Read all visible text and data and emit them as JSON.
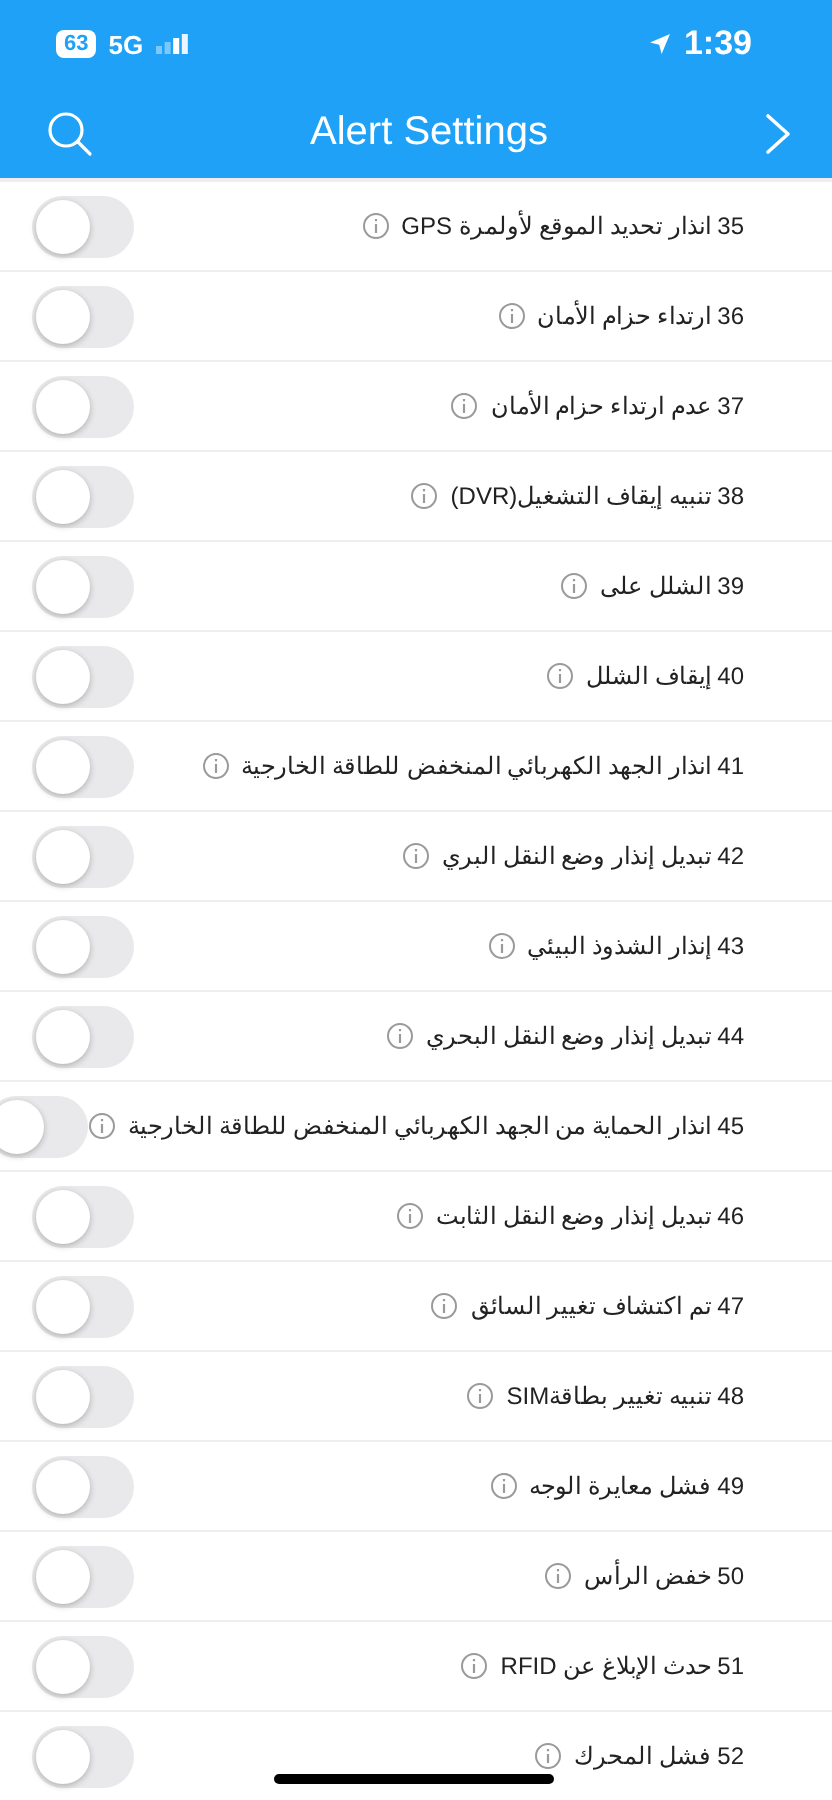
{
  "status_bar": {
    "battery": "63",
    "network": "5G",
    "time": "1:39"
  },
  "header": {
    "title": "Alert Settings"
  },
  "alerts": [
    {
      "label": "35 انذار تحديد الموقع لأولمرة GPS",
      "on": false
    },
    {
      "label": "36 ارتداء حزام الأمان",
      "on": false
    },
    {
      "label": "37 عدم ارتداء حزام الأمان",
      "on": false
    },
    {
      "label": "38 تنبيه إيقاف التشغيل(DVR)",
      "on": false
    },
    {
      "label": "39 الشلل على",
      "on": false
    },
    {
      "label": "40 إيقاف الشلل",
      "on": false
    },
    {
      "label": "41 انذار الجهد الكهربائي المنخفض للطاقة الخارجية",
      "on": false
    },
    {
      "label": "42 تبديل إنذار وضع النقل البري",
      "on": false
    },
    {
      "label": "43 إنذار الشذوذ البيئي",
      "on": false
    },
    {
      "label": "44 تبديل إنذار وضع النقل البحري",
      "on": false
    },
    {
      "label": "45 انذار الحماية من الجهد الكهربائي المنخفض للطاقة الخارجية",
      "on": false
    },
    {
      "label": "46 تبديل إنذار وضع النقل الثابت",
      "on": false
    },
    {
      "label": "47 تم اكتشاف تغيير السائق",
      "on": false
    },
    {
      "label": "48 تنبيه تغيير بطاقةSIM",
      "on": false
    },
    {
      "label": "49 فشل معايرة الوجه",
      "on": false
    },
    {
      "label": "50 خفض الرأس",
      "on": false
    },
    {
      "label": "51 حدث الإبلاغ عن RFID",
      "on": false
    },
    {
      "label": "52 فشل المحرك",
      "on": false
    }
  ]
}
